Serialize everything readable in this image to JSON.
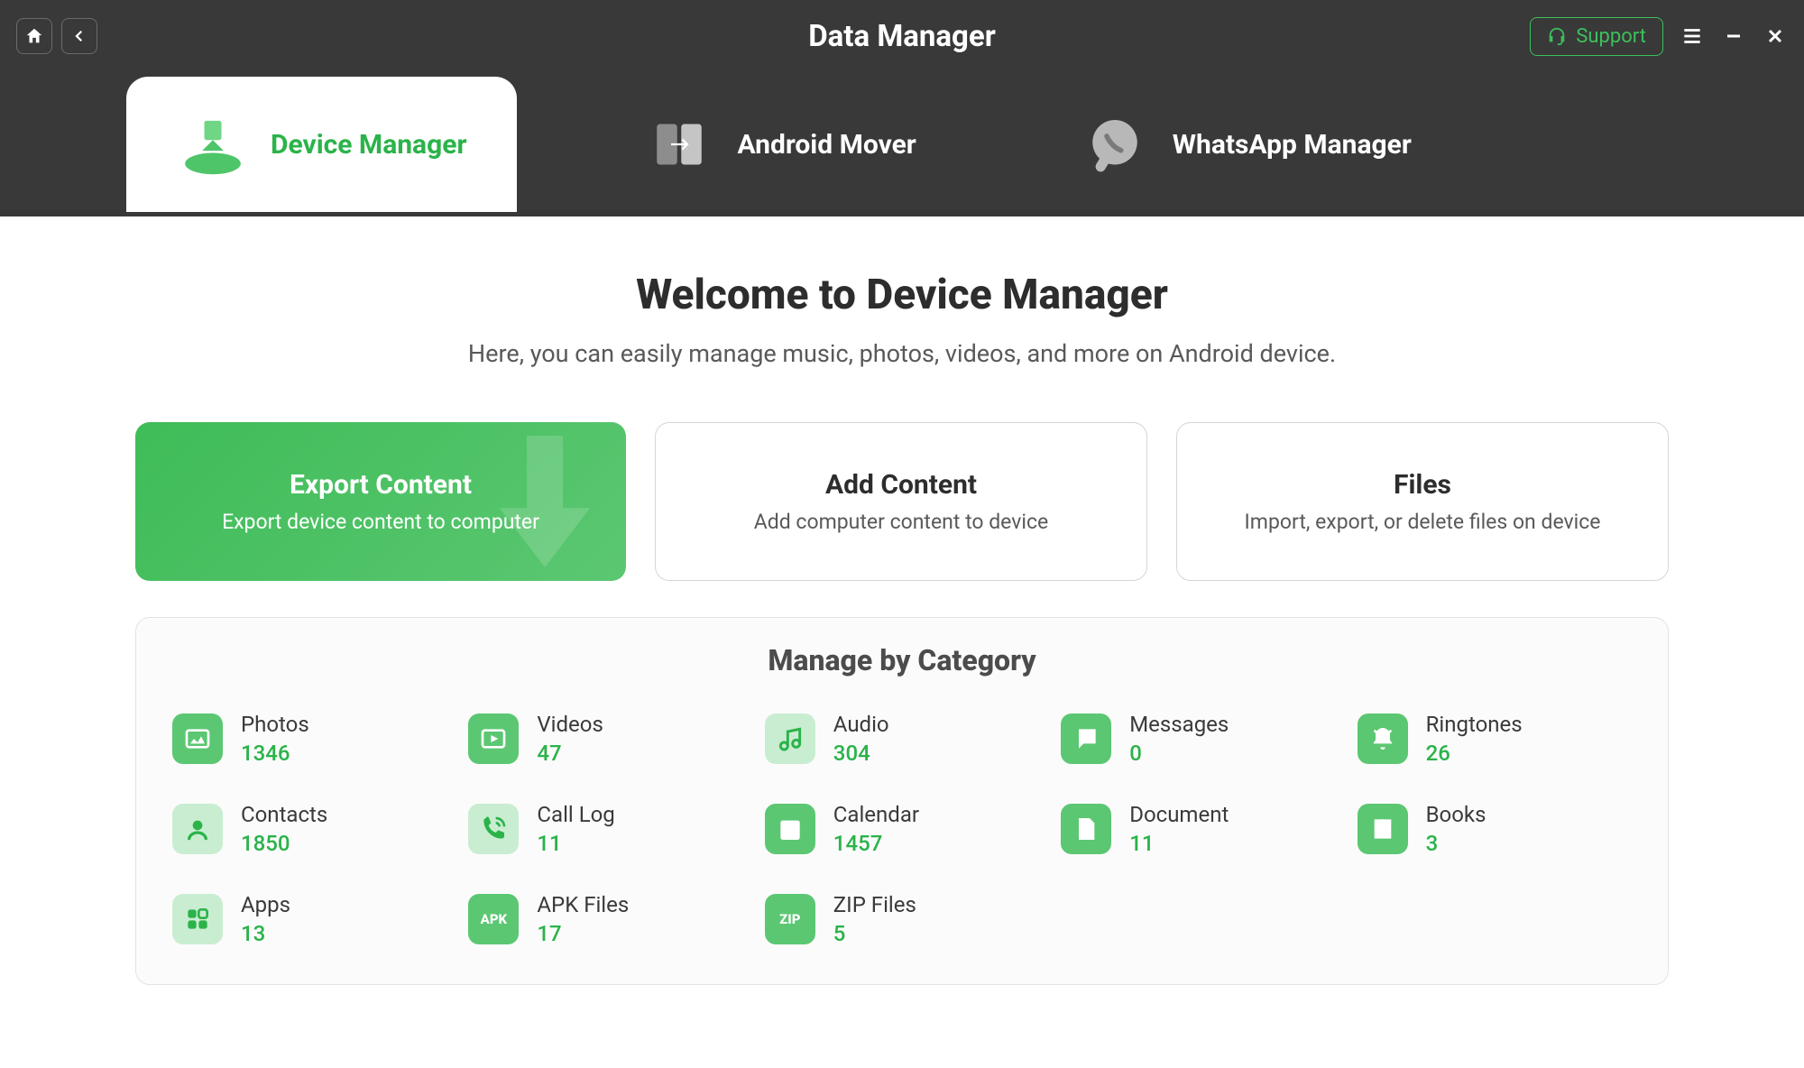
{
  "app_title": "Data Manager",
  "support_label": "Support",
  "tabs": [
    {
      "label": "Device Manager",
      "active": true
    },
    {
      "label": "Android Mover",
      "active": false
    },
    {
      "label": "WhatsApp Manager",
      "active": false
    }
  ],
  "welcome": {
    "title": "Welcome to Device Manager",
    "subtitle": "Here, you can easily manage music, photos, videos, and more on Android device."
  },
  "action_cards": [
    {
      "title": "Export Content",
      "subtitle": "Export device content to computer",
      "primary": true
    },
    {
      "title": "Add Content",
      "subtitle": "Add computer content to device",
      "primary": false
    },
    {
      "title": "Files",
      "subtitle": "Import, export, or delete files on device",
      "primary": false
    }
  ],
  "categories_title": "Manage by Category",
  "categories": [
    {
      "label": "Photos",
      "count": "1346",
      "icon": "photos"
    },
    {
      "label": "Videos",
      "count": "47",
      "icon": "videos"
    },
    {
      "label": "Audio",
      "count": "304",
      "icon": "audio"
    },
    {
      "label": "Messages",
      "count": "0",
      "icon": "messages"
    },
    {
      "label": "Ringtones",
      "count": "26",
      "icon": "ringtones"
    },
    {
      "label": "Contacts",
      "count": "1850",
      "icon": "contacts"
    },
    {
      "label": "Call Log",
      "count": "11",
      "icon": "call-log"
    },
    {
      "label": "Calendar",
      "count": "1457",
      "icon": "calendar"
    },
    {
      "label": "Document",
      "count": "11",
      "icon": "document"
    },
    {
      "label": "Books",
      "count": "3",
      "icon": "books"
    },
    {
      "label": "Apps",
      "count": "13",
      "icon": "apps"
    },
    {
      "label": "APK Files",
      "count": "17",
      "icon": "apk"
    },
    {
      "label": "ZIP Files",
      "count": "5",
      "icon": "zip"
    }
  ]
}
